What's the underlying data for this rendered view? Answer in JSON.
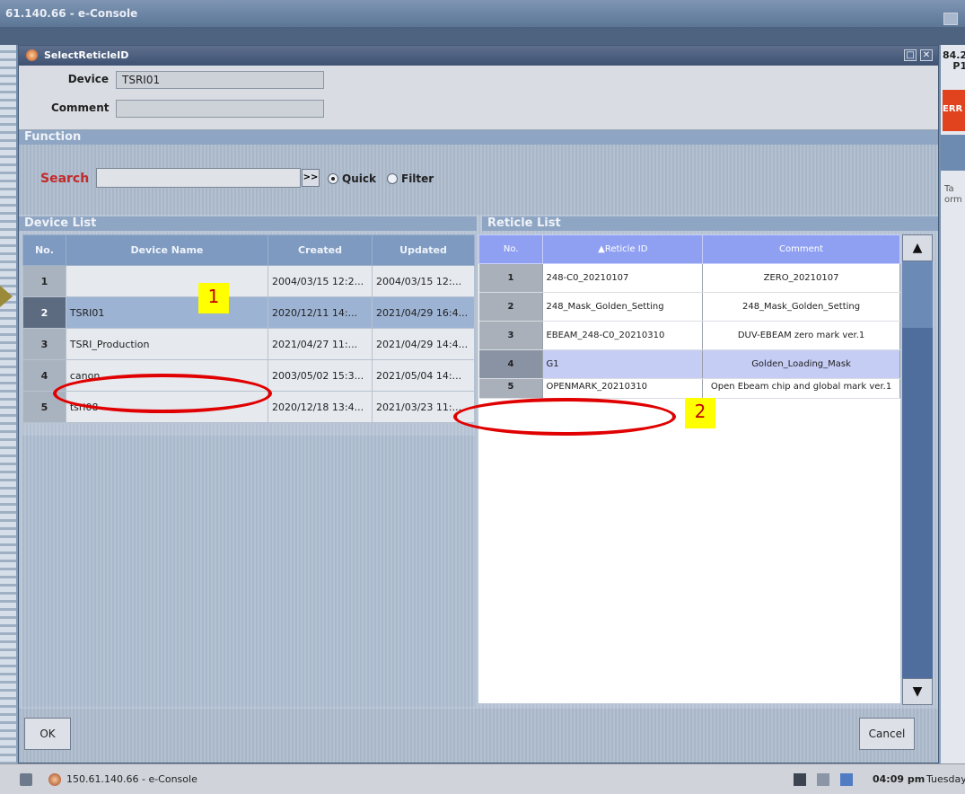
{
  "outer_window": {
    "title": "61.140.66 - e-Console",
    "right_number_1": "84.2",
    "right_number_2": "P1",
    "right_error": "ERR",
    "right_text_1": "Ta",
    "right_text_2": "orm"
  },
  "dialog": {
    "title": "SelectReticleID",
    "device_label": "Device",
    "device_value": "TSRI01",
    "comment_label": "Comment",
    "comment_value": "",
    "function_header": "Function",
    "search_label": "Search",
    "search_value": "",
    "search_go_label": ">>",
    "radio_quick": "Quick",
    "radio_filter": "Filter",
    "ok_label": "OK",
    "cancel_label": "Cancel"
  },
  "device_list": {
    "header": "Device List",
    "columns": [
      "No.",
      "Device Name",
      "Created",
      "Updated"
    ],
    "rows": [
      {
        "no": "1",
        "name": "",
        "created": "2004/03/15 12:2...",
        "updated": "2004/03/15 12:..."
      },
      {
        "no": "2",
        "name": "TSRI01",
        "created": "2020/12/11 14:...",
        "updated": "2021/04/29 16:4..."
      },
      {
        "no": "3",
        "name": "TSRI_Production",
        "created": "2021/04/27 11:...",
        "updated": "2021/04/29 14:4..."
      },
      {
        "no": "4",
        "name": "canon",
        "created": "2003/05/02 15:3...",
        "updated": "2021/05/04 14:..."
      },
      {
        "no": "5",
        "name": "tsri08",
        "created": "2020/12/18 13:4...",
        "updated": "2021/03/23 11:..."
      }
    ]
  },
  "reticle_list": {
    "header": "Reticle List",
    "columns": [
      "No.",
      "Reticle ID",
      "Comment"
    ],
    "rows": [
      {
        "no": "1",
        "id": "248-C0_20210107",
        "comment": "ZERO_20210107"
      },
      {
        "no": "2",
        "id": "248_Mask_Golden_Setting",
        "comment": "248_Mask_Golden_Setting"
      },
      {
        "no": "3",
        "id": "EBEAM_248-C0_20210310",
        "comment": "DUV-EBEAM zero mark ver.1"
      },
      {
        "no": "4",
        "id": "G1",
        "comment": "Golden_Loading_Mask"
      },
      {
        "no": "5",
        "id": "OPENMARK_20210310",
        "comment": "Open Ebeam chip and global mark ver.1"
      }
    ]
  },
  "annotations": {
    "label_1": "1",
    "label_2": "2"
  },
  "taskbar": {
    "window_label": "150.61.140.66 - e-Console",
    "time": "04:09 pm",
    "day": "Tuesday"
  },
  "colors": {
    "annotation_red": "#e00000",
    "annotation_yellow": "#ffff00",
    "reticle_header": "#8fa0f2"
  }
}
